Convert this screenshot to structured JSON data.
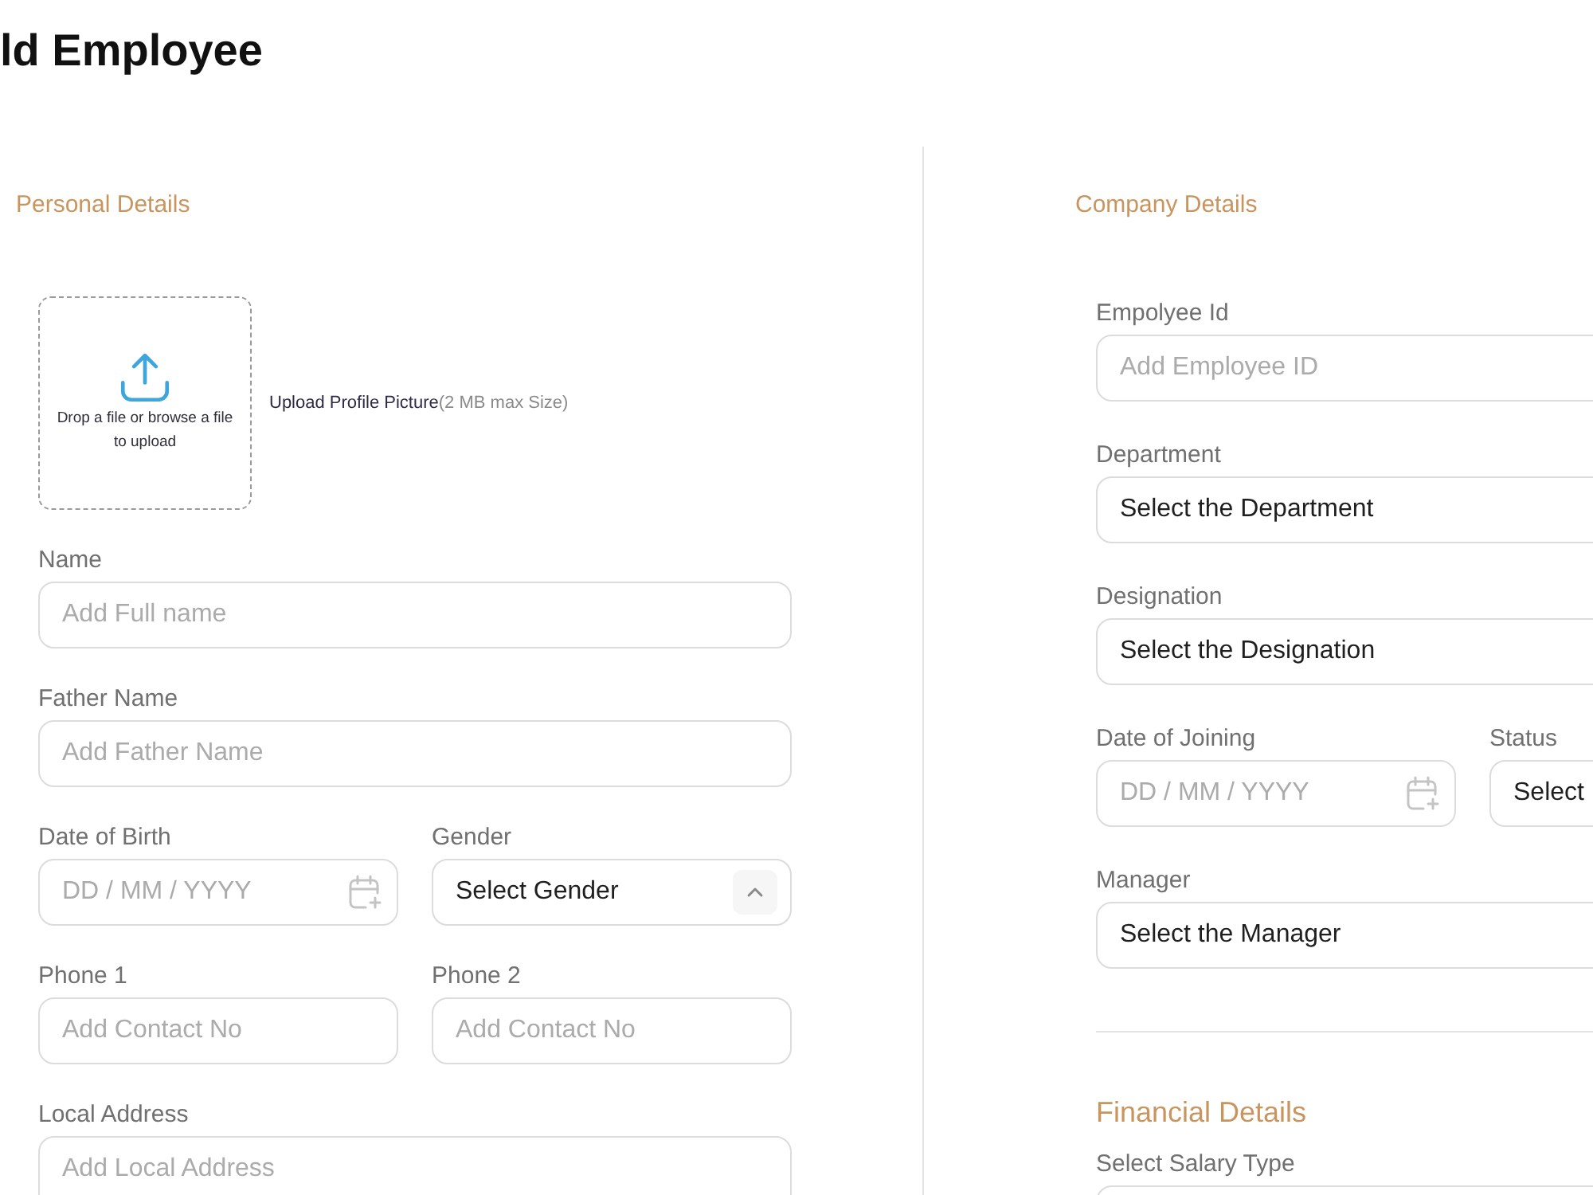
{
  "page": {
    "title": "ld Employee"
  },
  "personal_details": {
    "heading": "Personal Details",
    "upload": {
      "prompt": "Drop a file or browse a file to upload",
      "label": "Upload Profile Picture",
      "hint": "(2 MB max Size)"
    },
    "rows": [
      [
        {
          "label": "Name",
          "kind": "text",
          "placeholder": "Add Full name"
        }
      ],
      [
        {
          "label": "Father Name",
          "kind": "text",
          "placeholder": "Add Father Name"
        }
      ],
      [
        {
          "label": "Date of Birth",
          "kind": "date",
          "placeholder": "DD / MM / YYYY"
        },
        {
          "label": "Gender",
          "kind": "select",
          "value": "Select Gender",
          "chevron": true
        }
      ],
      [
        {
          "label": "Phone 1",
          "kind": "text",
          "placeholder": "Add Contact No"
        },
        {
          "label": "Phone 2",
          "kind": "text",
          "placeholder": "Add Contact No"
        }
      ],
      [
        {
          "label": "Local Address",
          "kind": "textarea",
          "placeholder": "Add Local Address"
        }
      ]
    ]
  },
  "company_details": {
    "heading": "Company Details",
    "rows": [
      [
        {
          "label": "Empolyee Id",
          "kind": "text",
          "placeholder": "Add Employee ID"
        }
      ],
      [
        {
          "label": "Department",
          "kind": "select",
          "value": "Select the Department"
        }
      ],
      [
        {
          "label": "Designation",
          "kind": "select",
          "value": "Select the Designation"
        }
      ],
      [
        {
          "label": "Date of Joining",
          "kind": "date",
          "placeholder": "DD / MM / YYYY"
        },
        {
          "label": "Status",
          "kind": "select",
          "value": "Select"
        }
      ],
      [
        {
          "label": "Manager",
          "kind": "select",
          "value": "Select the Manager"
        }
      ]
    ]
  },
  "financial_details": {
    "heading": "Financial Details",
    "rows": [
      [
        {
          "label": "Select Salary Type",
          "kind": "select"
        }
      ]
    ]
  }
}
